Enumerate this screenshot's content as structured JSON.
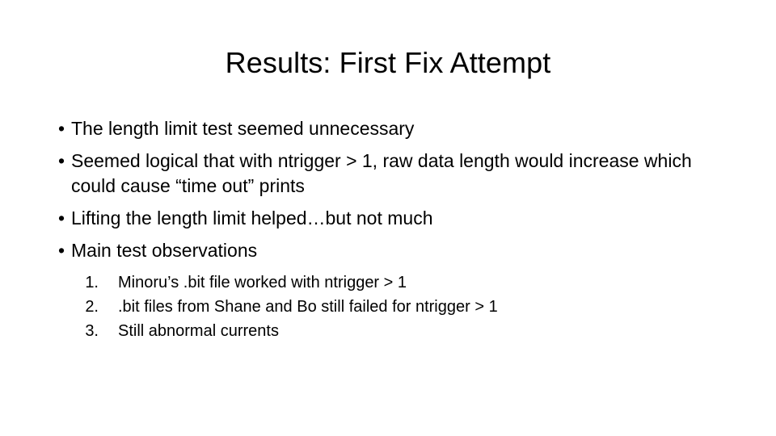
{
  "slide": {
    "title": "Results: First Fix Attempt",
    "background_color": "#ffffff",
    "text_color": "#000000",
    "bullet_glyph": "•",
    "bullets": [
      {
        "text": "The length limit test seemed unnecessary"
      },
      {
        "text": "Seemed logical that with ntrigger > 1, raw data length would increase which could cause “time out” prints"
      },
      {
        "text": "Lifting the length limit helped…but not much"
      },
      {
        "text": "Main test observations"
      }
    ],
    "numbered_list": [
      {
        "number": "1.",
        "text": "Minoru’s .bit file worked with ntrigger > 1"
      },
      {
        "number": "2.",
        "text": ".bit files from Shane and Bo still failed for ntrigger > 1"
      },
      {
        "number": "3.",
        "text": "Still abnormal currents"
      }
    ]
  }
}
